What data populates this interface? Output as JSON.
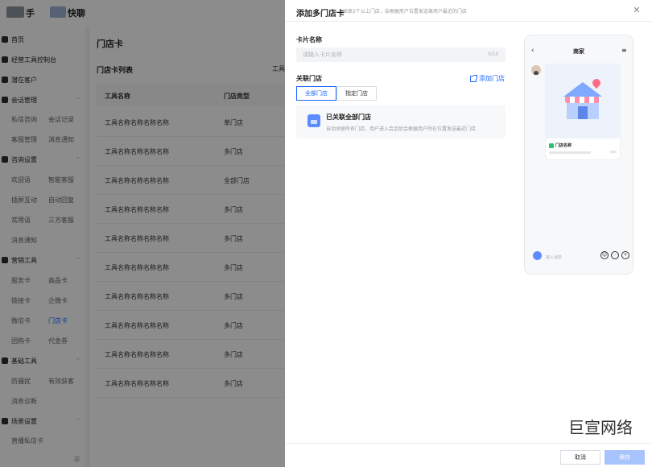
{
  "topbar": {
    "brand_a": "手",
    "brand_b": "快聊"
  },
  "sidebar": {
    "sections": [
      {
        "label": "首页"
      },
      {
        "label": "经营工具控制台"
      },
      {
        "label": "潜在客户"
      },
      {
        "label": "会话管理"
      },
      {
        "label": "咨询设置"
      },
      {
        "label": "营销工具"
      },
      {
        "label": "基础工具"
      },
      {
        "label": "场景设置"
      }
    ],
    "items": [
      "私信咨询",
      "会话记录",
      "客服管理",
      "消息通知",
      "欢迎语",
      "智能客服",
      "插屏互动",
      "自动回复",
      "常用语",
      "三方客服",
      "消息通知",
      "服务卡",
      "商品卡",
      "链接卡",
      "企微卡",
      "微信卡",
      "门店卡",
      "团购卡",
      "代金券",
      "防骚扰",
      "有效获客",
      "消息诊断",
      "直播私信卡"
    ],
    "footer_icon": "menu-collapse-icon"
  },
  "main": {
    "title": "门店卡",
    "list_title": "门店卡列表",
    "list_tool": "工具",
    "columns": [
      "工具名称",
      "门店类型"
    ],
    "rows": [
      [
        "工具名称名称名称名称",
        "单门店"
      ],
      [
        "工具名称名称名称名称",
        "多门店"
      ],
      [
        "工具名称名称名称名称",
        "全部门店"
      ],
      [
        "工具名称名称名称名称",
        "多门店"
      ],
      [
        "工具名称名称名称名称",
        "多门店"
      ],
      [
        "工具名称名称名称名称",
        "多门店"
      ],
      [
        "工具名称名称名称名称",
        "多门店"
      ],
      [
        "工具名称名称名称名称",
        "多门店"
      ],
      [
        "工具名称名称名称名称",
        "多门店"
      ],
      [
        "工具名称名称名称名称",
        "多门店"
      ]
    ]
  },
  "drawer": {
    "title": "添加多门店卡",
    "description": "关联2个以上门店，会根据用户位置发送离用户最近的门店",
    "close_icon": "close-icon",
    "card_name_label": "卡片名称",
    "card_name_placeholder": "请输入卡片名称",
    "card_name_value": "",
    "counter": "0/10",
    "store_label": "关联门店",
    "add_store": "添加门店",
    "segments": [
      "全部门店",
      "指定门店"
    ],
    "selected_segment": "全部门店",
    "info_title": "已关联全部门店",
    "info_sub": "自动关联所有门店，用户进入会话后会根据用户所在位置发送最近门店",
    "footer": {
      "cancel": "取消",
      "save": "保存"
    }
  },
  "preview": {
    "back_icon": "back-arrow-icon",
    "contact": "商家",
    "menu_icon": "menu-icon",
    "store_name": "门店名称",
    "input_placeholder": "输入消息"
  },
  "watermark": "巨宣网络",
  "colors": {
    "accent": "#1a66ff",
    "mask": "rgba(0,0,0,0.45)",
    "save_disabled": "#a8c4ff"
  }
}
